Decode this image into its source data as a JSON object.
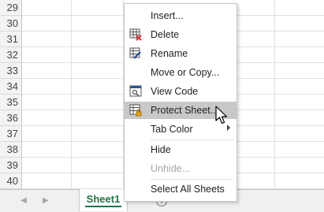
{
  "rows": [
    "29",
    "30",
    "31",
    "32",
    "33",
    "34",
    "35",
    "36",
    "37",
    "38",
    "39",
    "40"
  ],
  "sheet_tab": {
    "label": "Sheet1",
    "color": "#217346"
  },
  "context_menu": {
    "items": [
      {
        "label": "Insert...",
        "icon": "none",
        "disabled": false,
        "highlighted": false
      },
      {
        "label": "Delete",
        "icon": "delete-sheet-icon",
        "disabled": false,
        "highlighted": false
      },
      {
        "label": "Rename",
        "icon": "rename-sheet-icon",
        "disabled": false,
        "highlighted": false
      },
      {
        "label": "Move or Copy...",
        "icon": "none",
        "disabled": false,
        "highlighted": false
      },
      {
        "label": "View Code",
        "icon": "view-code-icon",
        "disabled": false,
        "highlighted": false
      },
      {
        "label": "Protect Sheet...",
        "icon": "protect-sheet-icon",
        "disabled": false,
        "highlighted": true
      },
      {
        "label": "Tab Color",
        "icon": "none",
        "disabled": false,
        "highlighted": false,
        "submenu": true
      },
      {
        "label": "Hide",
        "icon": "none",
        "disabled": false,
        "highlighted": false
      },
      {
        "label": "Unhide...",
        "icon": "none",
        "disabled": true,
        "highlighted": false
      },
      {
        "label": "Select All Sheets",
        "icon": "none",
        "disabled": false,
        "highlighted": false
      }
    ]
  }
}
